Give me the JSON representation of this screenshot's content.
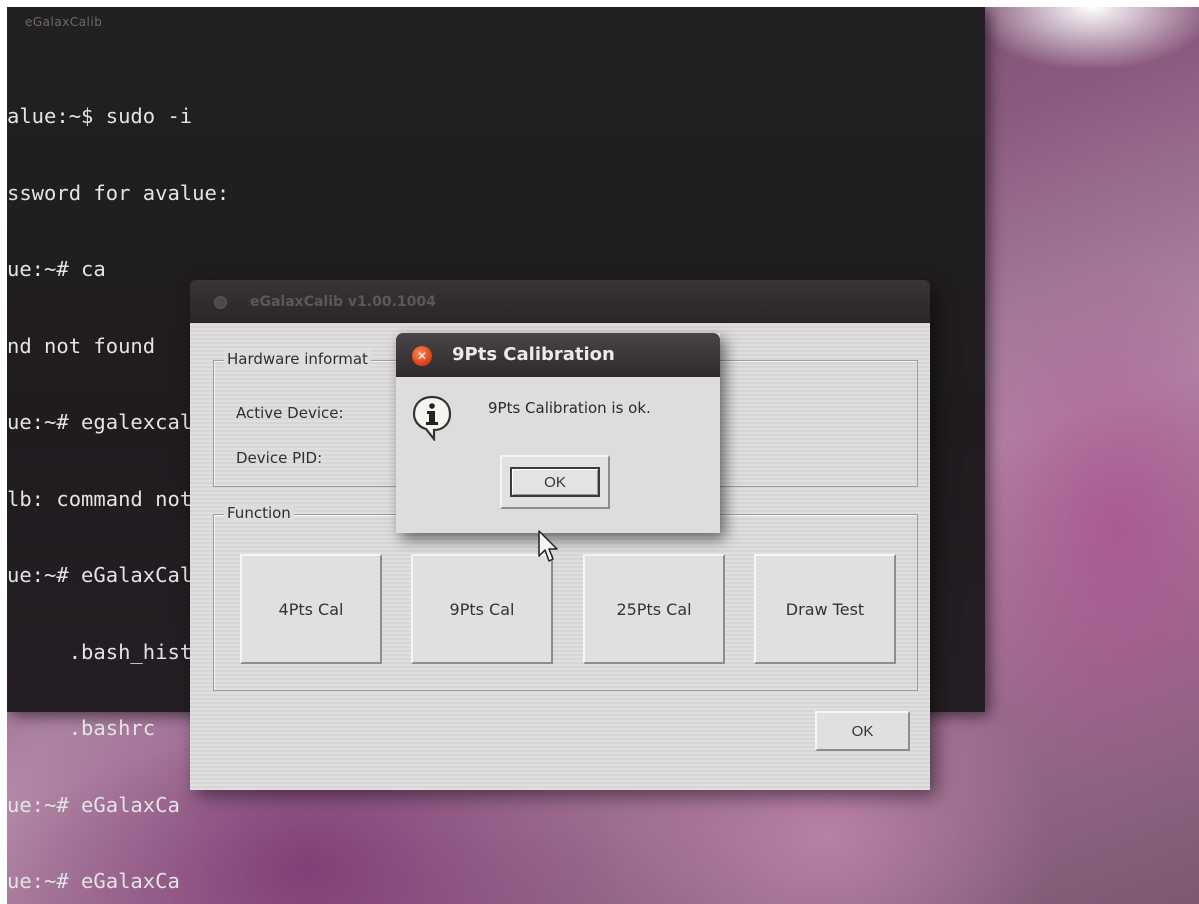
{
  "terminal": {
    "title": "eGalaxCalib",
    "lines": [
      "alue:~$ sudo -i",
      "ssword for avalue:",
      "ue:~# ca",
      "nd not found",
      "ue:~# egalexcalib",
      "lb: command not found",
      "ue:~# eGalaxCalib .",
      "     .bash_history  .config/       .pulse/       .vim/",
      "     .bashrc",
      "ue:~# eGalaxCa",
      "ue:~# eGalaxCa"
    ]
  },
  "calib_window": {
    "title": "eGalaxCalib v1.00.1004",
    "hardware_group": "Hardware informat",
    "active_device_label": "Active Device:",
    "device_pid_label": "Device PID:",
    "function_group": "Function",
    "buttons": [
      "4Pts Cal",
      "9Pts Cal",
      "25Pts Cal",
      "Draw Test"
    ],
    "ok_label": "OK"
  },
  "dialog": {
    "title": "9Pts Calibration",
    "message": "9Pts Calibration is ok.",
    "ok_label": "OK",
    "icon": "info-icon"
  },
  "colors": {
    "terminal_bg": "#211d21",
    "window_bg": "#dedddb",
    "titlebar": "#2f2a2d",
    "close_button": "#e0461e",
    "wallpaper": "#8a5a7e"
  }
}
